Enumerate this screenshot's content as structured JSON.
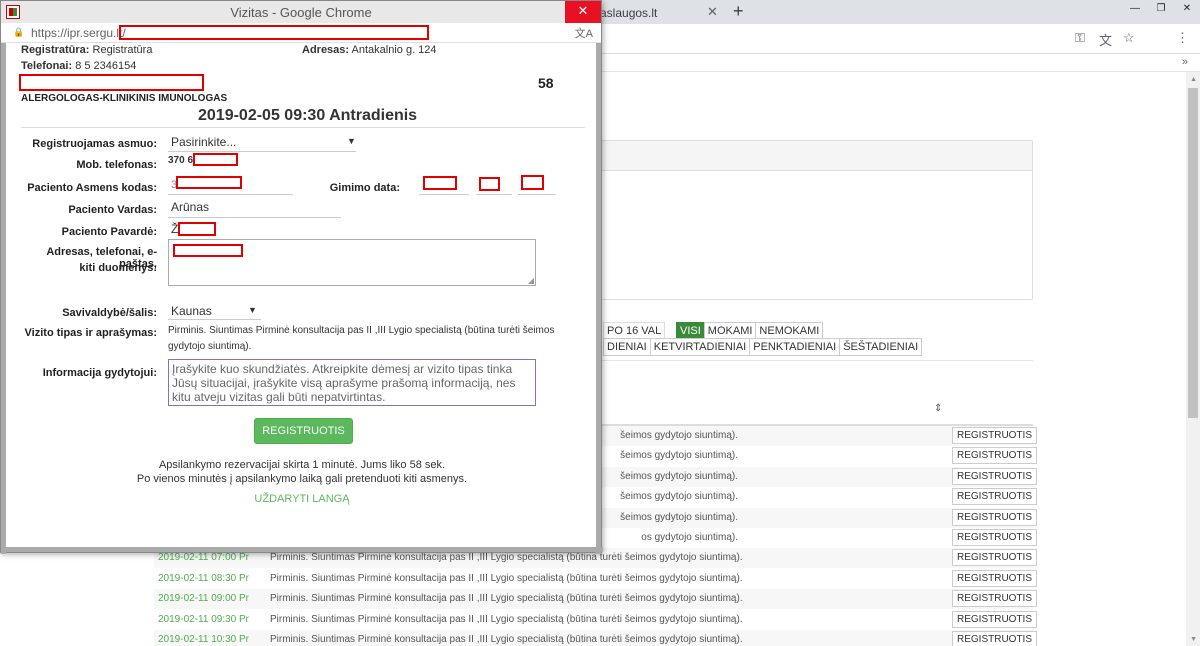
{
  "background": {
    "tab_title": "aslaugos.lt",
    "filters": {
      "time_filter": "PO 16 VAL",
      "type_buttons": [
        {
          "label": "VISI",
          "active": true
        },
        {
          "label": "MOKAMI",
          "active": false
        },
        {
          "label": "NEMOKAMI",
          "active": false
        }
      ],
      "day_buttons": [
        "DIENIAI",
        "KETVIRTADIENIAI",
        "PENKTADIENIAI",
        "ŠEŠTADIENIAI"
      ]
    },
    "rows": [
      {
        "datetime": "",
        "visit": "šeimos gydytojo siuntimą).",
        "button": "REGISTRUOTIS"
      },
      {
        "datetime": "",
        "visit": "šeimos gydytojo siuntimą).",
        "button": "REGISTRUOTIS"
      },
      {
        "datetime": "",
        "visit": "šeimos gydytojo siuntimą).",
        "button": "REGISTRUOTIS"
      },
      {
        "datetime": "",
        "visit": "šeimos gydytojo siuntimą).",
        "button": "REGISTRUOTIS"
      },
      {
        "datetime": "",
        "visit": "šeimos gydytojo siuntimą).",
        "button": "REGISTRUOTIS"
      },
      {
        "datetime": "",
        "visit": "os gydytojo siuntimą).",
        "button": "REGISTRUOTIS"
      },
      {
        "datetime": "2019-02-11 07:00 Pr",
        "visit": "Pirminis. Siuntimas Pirminė konsultacija pas II ,III Lygio specialistą (būtina turėti šeimos gydytojo siuntimą).",
        "button": "REGISTRUOTIS"
      },
      {
        "datetime": "2019-02-11 08:30 Pr",
        "visit": "Pirminis. Siuntimas Pirminė konsultacija pas II ,III Lygio specialistą (būtina turėti šeimos gydytojo siuntimą).",
        "button": "REGISTRUOTIS"
      },
      {
        "datetime": "2019-02-11 09:00 Pr",
        "visit": "Pirminis. Siuntimas Pirminė konsultacija pas II ,III Lygio specialistą (būtina turėti šeimos gydytojo siuntimą).",
        "button": "REGISTRUOTIS"
      },
      {
        "datetime": "2019-02-11 09:30 Pr",
        "visit": "Pirminis. Siuntimas Pirminė konsultacija pas II ,III Lygio specialistą (būtina turėti šeimos gydytojo siuntimą).",
        "button": "REGISTRUOTIS"
      },
      {
        "datetime": "2019-02-11 10:30 Pr",
        "visit": "Pirminis. Siuntimas Pirminė konsultacija pas II ,III Lygio specialistą (būtina turėti šeimos gydytojo siuntimą).",
        "button": "REGISTRUOTIS"
      }
    ]
  },
  "popup": {
    "window_title": "Vizitas - Google Chrome",
    "url_prefix": "https://ipr.sergu.lt/",
    "close_glyph": "✕",
    "header": {
      "registratura_label": "Registratūra:",
      "registratura_value": "Registratūra",
      "adresas_label": "Adresas:",
      "adresas_value": "Antakalnio g. 124",
      "telefonai_label": "Telefonai:",
      "telefonai_value": "8 5 2346154",
      "number": "58",
      "specialty": "ALERGOLOGAS-KLINIKINIS IMUNOLOGAS",
      "datetime": "2019-02-05 09:30  Antradienis"
    },
    "form": {
      "person_label": "Registruojamas asmuo:",
      "person_value": "Pasirinkite...",
      "phone_label": "Mob. telefonas:",
      "phone_value": "370 6",
      "code_label": "Paciento Asmens kodas:",
      "code_value": "3",
      "birth_label": "Gimimo data:",
      "name_label": "Paciento Vardas:",
      "name_value": "Arūnas",
      "surname_label": "Paciento Pavardė:",
      "surname_value": "Ž",
      "address_label_1": "Adresas, telefonai, e-paštas,",
      "address_label_2": "kiti duomenys:",
      "municipality_label": "Savivaldybė/šalis:",
      "municipality_value": "Kaunas",
      "visit_type_label": "Vizito tipas ir aprašymas:",
      "visit_type_line1": "Pirminis. Siuntimas Pirminė konsultacija pas II ,III Lygio specialistą (būtina turėti šeimos",
      "visit_type_line2": "gydytojo siuntimą).",
      "doctor_info_label": "Informacija gydytojui:",
      "doctor_info_placeholder": "Įrašykite kuo skundžiatės. Atkreipkite dėmesį ar vizito tipas tinka Jūsų situacijai, įrašykite visą aprašyme prašomą informaciją, nes kitu atveju vizitas gali būti nepatvirtintas.",
      "submit_label": "REGISTRUOTIS",
      "info_line1": "Apsilankymo rezervacijai skirta 1 minutė. Jums liko 58 sek.",
      "info_line2": "Po vienos minutės į apsilankymo laiką gali pretenduoti kiti asmenys.",
      "close_link": "UŽDARYTI LANGĄ"
    }
  },
  "colors": {
    "accent_green": "#5cb85c",
    "redact": "#e00000",
    "close_red": "#e81123"
  }
}
